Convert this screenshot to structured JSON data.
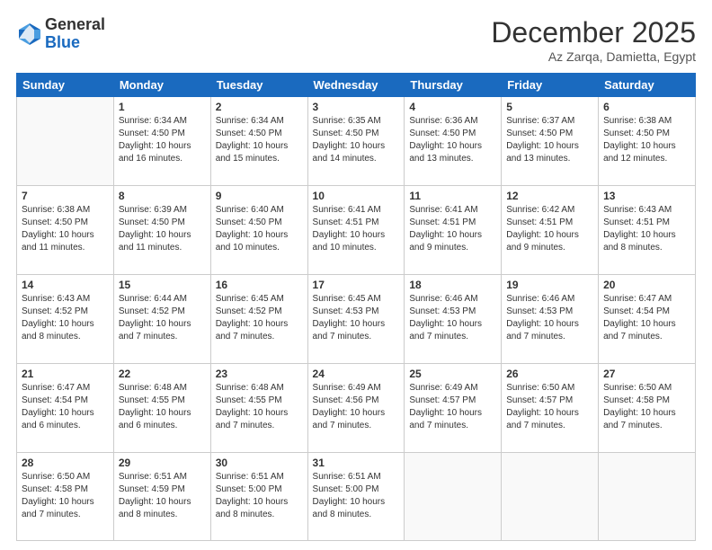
{
  "logo": {
    "general": "General",
    "blue": "Blue"
  },
  "title": "December 2025",
  "location": "Az Zarqa, Damietta, Egypt",
  "days_of_week": [
    "Sunday",
    "Monday",
    "Tuesday",
    "Wednesday",
    "Thursday",
    "Friday",
    "Saturday"
  ],
  "weeks": [
    [
      {
        "day": "",
        "info": ""
      },
      {
        "day": "1",
        "info": "Sunrise: 6:34 AM\nSunset: 4:50 PM\nDaylight: 10 hours\nand 16 minutes."
      },
      {
        "day": "2",
        "info": "Sunrise: 6:34 AM\nSunset: 4:50 PM\nDaylight: 10 hours\nand 15 minutes."
      },
      {
        "day": "3",
        "info": "Sunrise: 6:35 AM\nSunset: 4:50 PM\nDaylight: 10 hours\nand 14 minutes."
      },
      {
        "day": "4",
        "info": "Sunrise: 6:36 AM\nSunset: 4:50 PM\nDaylight: 10 hours\nand 13 minutes."
      },
      {
        "day": "5",
        "info": "Sunrise: 6:37 AM\nSunset: 4:50 PM\nDaylight: 10 hours\nand 13 minutes."
      },
      {
        "day": "6",
        "info": "Sunrise: 6:38 AM\nSunset: 4:50 PM\nDaylight: 10 hours\nand 12 minutes."
      }
    ],
    [
      {
        "day": "7",
        "info": "Sunrise: 6:38 AM\nSunset: 4:50 PM\nDaylight: 10 hours\nand 11 minutes."
      },
      {
        "day": "8",
        "info": "Sunrise: 6:39 AM\nSunset: 4:50 PM\nDaylight: 10 hours\nand 11 minutes."
      },
      {
        "day": "9",
        "info": "Sunrise: 6:40 AM\nSunset: 4:50 PM\nDaylight: 10 hours\nand 10 minutes."
      },
      {
        "day": "10",
        "info": "Sunrise: 6:41 AM\nSunset: 4:51 PM\nDaylight: 10 hours\nand 10 minutes."
      },
      {
        "day": "11",
        "info": "Sunrise: 6:41 AM\nSunset: 4:51 PM\nDaylight: 10 hours\nand 9 minutes."
      },
      {
        "day": "12",
        "info": "Sunrise: 6:42 AM\nSunset: 4:51 PM\nDaylight: 10 hours\nand 9 minutes."
      },
      {
        "day": "13",
        "info": "Sunrise: 6:43 AM\nSunset: 4:51 PM\nDaylight: 10 hours\nand 8 minutes."
      }
    ],
    [
      {
        "day": "14",
        "info": "Sunrise: 6:43 AM\nSunset: 4:52 PM\nDaylight: 10 hours\nand 8 minutes."
      },
      {
        "day": "15",
        "info": "Sunrise: 6:44 AM\nSunset: 4:52 PM\nDaylight: 10 hours\nand 7 minutes."
      },
      {
        "day": "16",
        "info": "Sunrise: 6:45 AM\nSunset: 4:52 PM\nDaylight: 10 hours\nand 7 minutes."
      },
      {
        "day": "17",
        "info": "Sunrise: 6:45 AM\nSunset: 4:53 PM\nDaylight: 10 hours\nand 7 minutes."
      },
      {
        "day": "18",
        "info": "Sunrise: 6:46 AM\nSunset: 4:53 PM\nDaylight: 10 hours\nand 7 minutes."
      },
      {
        "day": "19",
        "info": "Sunrise: 6:46 AM\nSunset: 4:53 PM\nDaylight: 10 hours\nand 7 minutes."
      },
      {
        "day": "20",
        "info": "Sunrise: 6:47 AM\nSunset: 4:54 PM\nDaylight: 10 hours\nand 7 minutes."
      }
    ],
    [
      {
        "day": "21",
        "info": "Sunrise: 6:47 AM\nSunset: 4:54 PM\nDaylight: 10 hours\nand 6 minutes."
      },
      {
        "day": "22",
        "info": "Sunrise: 6:48 AM\nSunset: 4:55 PM\nDaylight: 10 hours\nand 6 minutes."
      },
      {
        "day": "23",
        "info": "Sunrise: 6:48 AM\nSunset: 4:55 PM\nDaylight: 10 hours\nand 7 minutes."
      },
      {
        "day": "24",
        "info": "Sunrise: 6:49 AM\nSunset: 4:56 PM\nDaylight: 10 hours\nand 7 minutes."
      },
      {
        "day": "25",
        "info": "Sunrise: 6:49 AM\nSunset: 4:57 PM\nDaylight: 10 hours\nand 7 minutes."
      },
      {
        "day": "26",
        "info": "Sunrise: 6:50 AM\nSunset: 4:57 PM\nDaylight: 10 hours\nand 7 minutes."
      },
      {
        "day": "27",
        "info": "Sunrise: 6:50 AM\nSunset: 4:58 PM\nDaylight: 10 hours\nand 7 minutes."
      }
    ],
    [
      {
        "day": "28",
        "info": "Sunrise: 6:50 AM\nSunset: 4:58 PM\nDaylight: 10 hours\nand 7 minutes."
      },
      {
        "day": "29",
        "info": "Sunrise: 6:51 AM\nSunset: 4:59 PM\nDaylight: 10 hours\nand 8 minutes."
      },
      {
        "day": "30",
        "info": "Sunrise: 6:51 AM\nSunset: 5:00 PM\nDaylight: 10 hours\nand 8 minutes."
      },
      {
        "day": "31",
        "info": "Sunrise: 6:51 AM\nSunset: 5:00 PM\nDaylight: 10 hours\nand 8 minutes."
      },
      {
        "day": "",
        "info": ""
      },
      {
        "day": "",
        "info": ""
      },
      {
        "day": "",
        "info": ""
      }
    ]
  ]
}
